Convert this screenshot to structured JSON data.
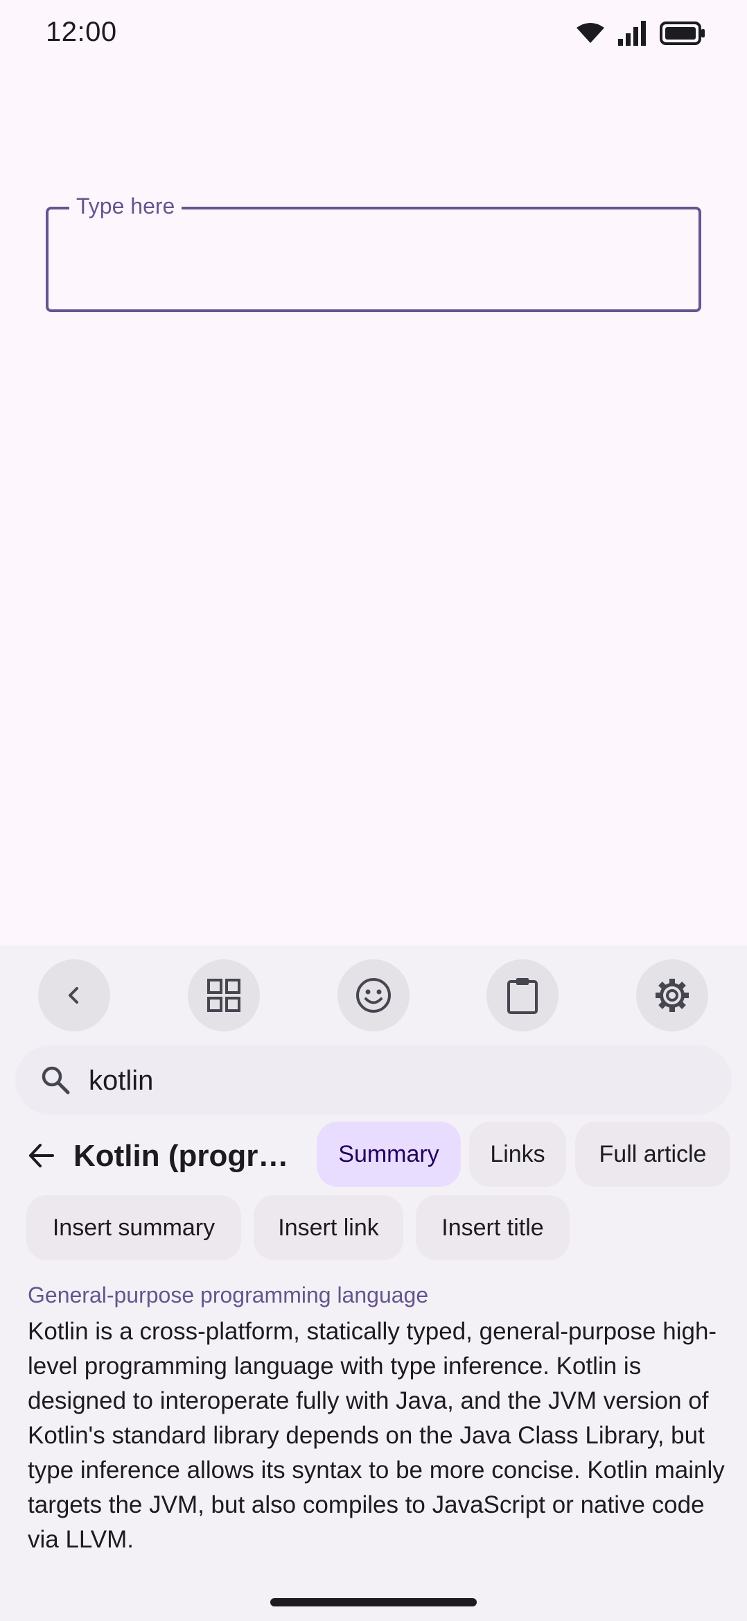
{
  "status_bar": {
    "time": "12:00",
    "icons": [
      "wifi-icon",
      "signal-icon",
      "battery-icon"
    ]
  },
  "text_field": {
    "label": "Type here",
    "value": ""
  },
  "keyboard": {
    "toolbar": [
      {
        "icon": "chevron-left-icon"
      },
      {
        "icon": "grid-icon"
      },
      {
        "icon": "emoji-icon"
      },
      {
        "icon": "clipboard-icon"
      },
      {
        "icon": "gear-icon"
      }
    ],
    "search": {
      "icon": "search-icon",
      "query": "kotlin"
    },
    "article": {
      "title": "Kotlin (programming language)",
      "tabs": [
        {
          "label": "Summary",
          "selected": true
        },
        {
          "label": "Links",
          "selected": false
        },
        {
          "label": "Full article",
          "selected": false
        }
      ],
      "actions": [
        {
          "label": "Insert summary"
        },
        {
          "label": "Insert link"
        },
        {
          "label": "Insert title"
        }
      ],
      "subtitle": "General-purpose programming language",
      "summary": "Kotlin is a cross-platform, statically typed, general-purpose high-level programming language with type inference. Kotlin is designed to interoperate fully with Java, and the JVM version of Kotlin's standard library depends on the Java Class Library, but type inference allows its syntax to be more concise. Kotlin mainly targets the JVM, but also compiles to JavaScript or native code via LLVM."
    }
  },
  "colors": {
    "background": "#fdf7fd",
    "keyboard_background": "#f4f1f6",
    "accent": "#65558f",
    "selected_chip": "#e9ddff",
    "chip": "#ece8ee",
    "text": "#1c1b1f"
  }
}
